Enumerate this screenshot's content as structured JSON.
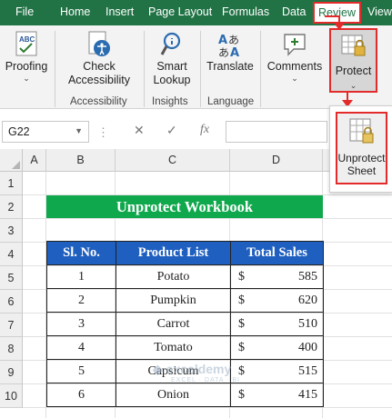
{
  "ribbon_tabs": [
    "File",
    "Home",
    "Insert",
    "Page Layout",
    "Formulas",
    "Data",
    "Review",
    "View"
  ],
  "ribbon": {
    "proofing": "Proofing",
    "check_accessibility": [
      "Check",
      "Accessibility"
    ],
    "accessibility_group": "Accessibility",
    "smart_lookup": [
      "Smart",
      "Lookup"
    ],
    "insights_group": "Insights",
    "translate": "Translate",
    "language_group": "Language",
    "comments": "Comments",
    "protect": "Protect",
    "unprotect_sheet": [
      "Unprotect",
      "Sheet"
    ]
  },
  "formula_bar": {
    "name_box": "G22",
    "cancel_symbol": "✕",
    "enter_symbol": "✓",
    "fx_symbol": "fx",
    "formula": ""
  },
  "grid": {
    "columns": [
      "A",
      "B",
      "C",
      "D"
    ],
    "rows": [
      "1",
      "2",
      "3",
      "4",
      "5",
      "6",
      "7",
      "8",
      "9",
      "10"
    ]
  },
  "sheet": {
    "title": "Unprotect Workbook",
    "headers": [
      "Sl. No.",
      "Product List",
      "Total Sales"
    ],
    "rows": [
      {
        "sl": "1",
        "product": "Potato",
        "currency": "$",
        "sales": "585"
      },
      {
        "sl": "2",
        "product": "Pumpkin",
        "currency": "$",
        "sales": "620"
      },
      {
        "sl": "3",
        "product": "Carrot",
        "currency": "$",
        "sales": "510"
      },
      {
        "sl": "4",
        "product": "Tomato",
        "currency": "$",
        "sales": "400"
      },
      {
        "sl": "5",
        "product": "Capsicum",
        "currency": "$",
        "sales": "515"
      },
      {
        "sl": "6",
        "product": "Onion",
        "currency": "$",
        "sales": "415"
      }
    ]
  },
  "watermark": {
    "name": "exceldemy",
    "tagline": "EXCEL · DATA · BI"
  },
  "colors": {
    "excel_green": "#217346",
    "title_green": "#0fa84d",
    "header_blue": "#1f5fbf",
    "highlight_red": "#e32b2b"
  }
}
